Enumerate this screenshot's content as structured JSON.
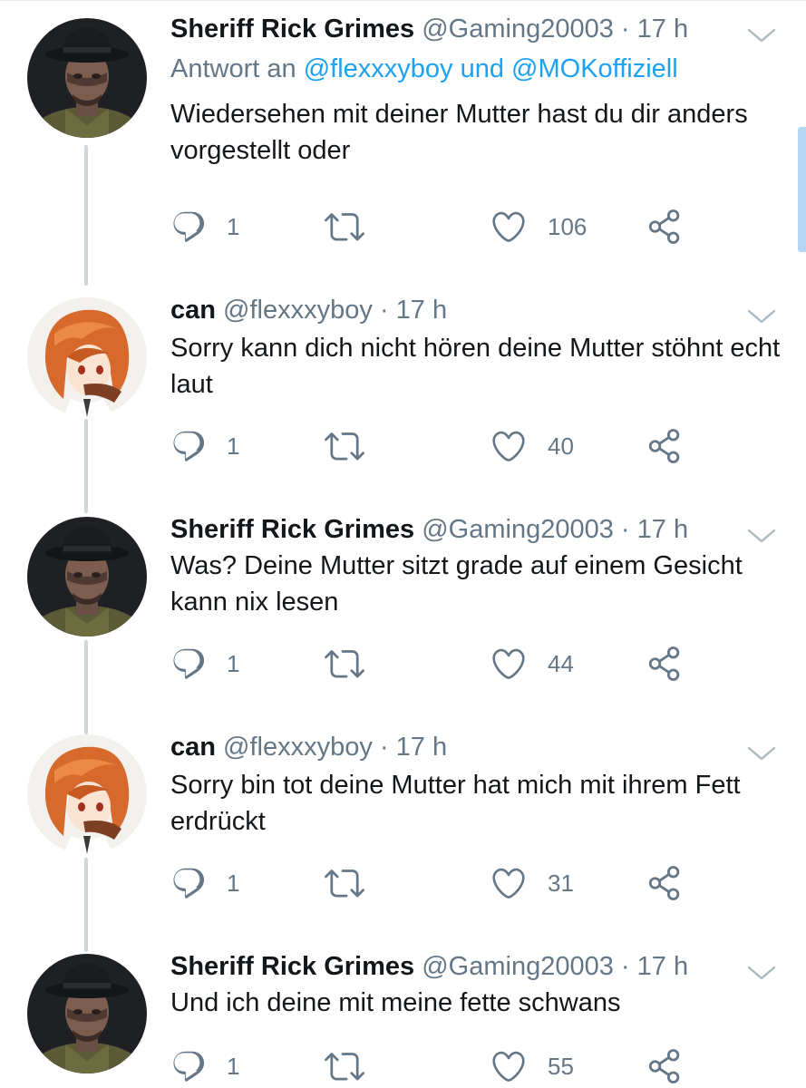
{
  "colors": {
    "link": "#1da1f2",
    "secondary": "#657786",
    "text": "#14171a",
    "thread": "#ccd6dd"
  },
  "tweets": [
    {
      "name": "Sheriff Rick Grimes",
      "handle": "@Gaming20003",
      "separator": "·",
      "time": "17 h",
      "reply_prefix": "Antwort an",
      "reply_to_1": "@flexxxyboy",
      "reply_and": "und",
      "reply_to_2": "@MOKoffiziell",
      "text": "Wiedersehen mit deiner Mutter hast du dir anders vorgestellt oder",
      "replies": "1",
      "likes": "106",
      "avatar": "rick-grimes-avatar"
    },
    {
      "name": "can",
      "handle": "@flexxxyboy",
      "separator": "·",
      "time": "17 h",
      "text": "Sorry kann dich nicht hören deine Mutter stöhnt echt laut",
      "replies": "1",
      "likes": "40",
      "avatar": "anime-avatar"
    },
    {
      "name": "Sheriff Rick Grimes",
      "handle": "@Gaming20003",
      "separator": "·",
      "time": "17 h",
      "text": "Was? Deine Mutter sitzt grade auf einem Gesicht kann nix lesen",
      "replies": "1",
      "likes": "44",
      "avatar": "rick-grimes-avatar"
    },
    {
      "name": "can",
      "handle": "@flexxxyboy",
      "separator": "·",
      "time": "17 h",
      "text": "Sorry bin tot deine Mutter hat mich mit ihrem Fett erdrückt",
      "replies": "1",
      "likes": "31",
      "avatar": "anime-avatar"
    },
    {
      "name": "Sheriff Rick Grimes",
      "handle": "@Gaming20003",
      "separator": "·",
      "time": "17 h",
      "text": "Und ich deine mit meine fette schwans",
      "replies": "1",
      "likes": "55",
      "avatar": "rick-grimes-avatar"
    }
  ]
}
